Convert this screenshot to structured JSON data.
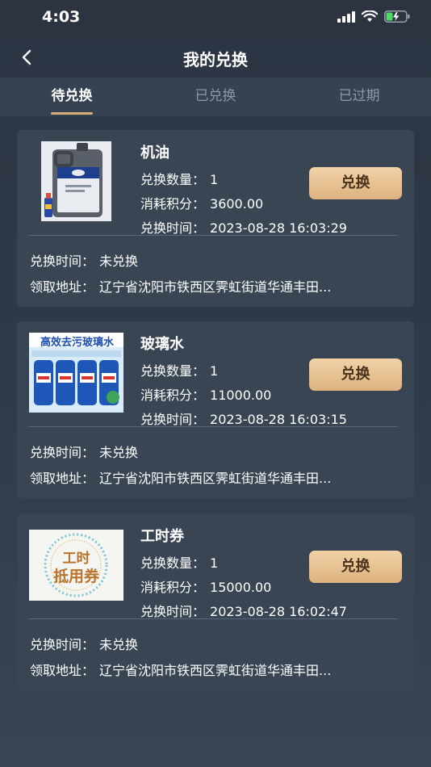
{
  "status": {
    "time": "4:03"
  },
  "nav": {
    "title": "我的兑换"
  },
  "tabs": [
    {
      "label": "待兑换",
      "active": true
    },
    {
      "label": "已兑换",
      "active": false
    },
    {
      "label": "已过期",
      "active": false
    }
  ],
  "labels": {
    "quantity": "兑换数量：",
    "points": "消耗积分：",
    "time": "兑换时间：",
    "redeem_time": "兑换时间：",
    "address": "领取地址：",
    "redeem_button": "兑换"
  },
  "items": [
    {
      "name": "机油",
      "image": "engine-oil-image",
      "quantity": "1",
      "points": "3600.00",
      "time": "2023-08-28 16:03:29",
      "redeem_status": "未兑换",
      "address": "辽宁省沈阳市铁西区霁虹街道华通丰田..."
    },
    {
      "name": "玻璃水",
      "image": "washer-fluid-image",
      "image_banner": "高效去污玻璃水",
      "quantity": "1",
      "points": "11000.00",
      "time": "2023-08-28 16:03:15",
      "redeem_status": "未兑换",
      "address": "辽宁省沈阳市铁西区霁虹街道华通丰田..."
    },
    {
      "name": "工时券",
      "image": "labor-voucher-image",
      "image_text_1": "工时",
      "image_text_2": "抵用券",
      "quantity": "1",
      "points": "15000.00",
      "time": "2023-08-28 16:02:47",
      "redeem_status": "未兑换",
      "address": "辽宁省沈阳市铁西区霁虹街道华通丰田..."
    }
  ],
  "colors": {
    "background": "#2f3947",
    "card": "#3a4554",
    "tab_bar": "#364152",
    "accent": "#d7ad7a",
    "button_text": "#4a321c"
  }
}
